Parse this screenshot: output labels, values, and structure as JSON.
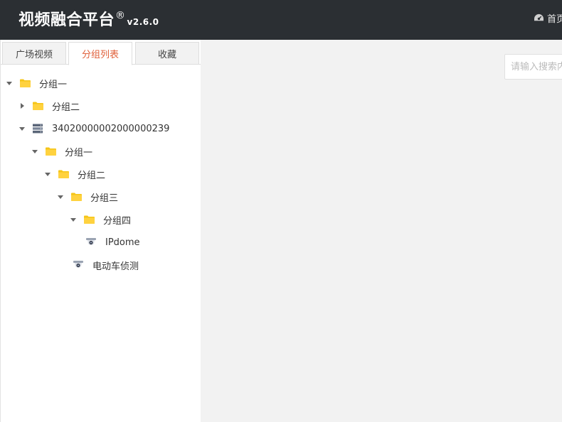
{
  "header": {
    "title": "视频融合平台",
    "registered": "®",
    "version": "v2.6.0",
    "home_label": "首页",
    "home_icon": "dashboard-icon"
  },
  "tabs": [
    {
      "label": "广场视频",
      "active": false
    },
    {
      "label": "分组列表",
      "active": true
    },
    {
      "label": "收藏",
      "active": false
    }
  ],
  "tree": [
    {
      "label": "分组一",
      "icon": "folder-icon",
      "expanded": true
    },
    {
      "label": "分组二",
      "icon": "folder-icon",
      "expanded": false
    },
    {
      "label": "34020000002000000239",
      "icon": "server-icon",
      "expanded": true
    },
    {
      "label": "分组一",
      "icon": "folder-icon",
      "expanded": true
    },
    {
      "label": "分组二",
      "icon": "folder-icon",
      "expanded": true
    },
    {
      "label": "分组三",
      "icon": "folder-icon",
      "expanded": true
    },
    {
      "label": "分组四",
      "icon": "folder-icon",
      "expanded": true
    },
    {
      "label": "IPdome",
      "icon": "camera-icon"
    },
    {
      "label": "电动车侦测",
      "icon": "camera-icon"
    }
  ],
  "search": {
    "placeholder": "请输入搜索内容"
  },
  "colors": {
    "header_bg": "#2b2f33",
    "accent": "#e0603a",
    "folder": "#f5c518"
  }
}
